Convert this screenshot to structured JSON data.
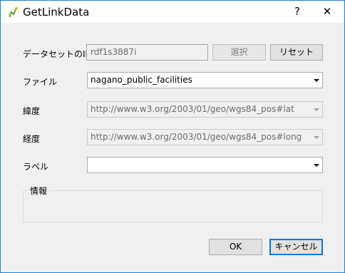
{
  "window": {
    "title": "GetLinkData",
    "help_label": "?",
    "close_label": "✕"
  },
  "fields": {
    "dataset_id": {
      "label": "データセットのID",
      "value": "rdf1s3887i",
      "select_label": "選択",
      "reset_label": "リセット"
    },
    "file": {
      "label": "ファイル",
      "value": "nagano_public_facilities"
    },
    "latitude": {
      "label": "緯度",
      "value": "http://www.w3.org/2003/01/geo/wgs84_pos#lat"
    },
    "longitude": {
      "label": "経度",
      "value": "http://www.w3.org/2003/01/geo/wgs84_pos#long"
    },
    "label": {
      "label": "ラベル",
      "value": ""
    }
  },
  "info": {
    "title": "情報"
  },
  "buttons": {
    "ok_label": "OK",
    "cancel_label": "キャンセル"
  },
  "colors": {
    "window_border": "#1883d7",
    "default_button_border": "#0078d7",
    "dialog_bg": "#f0f0f0"
  }
}
